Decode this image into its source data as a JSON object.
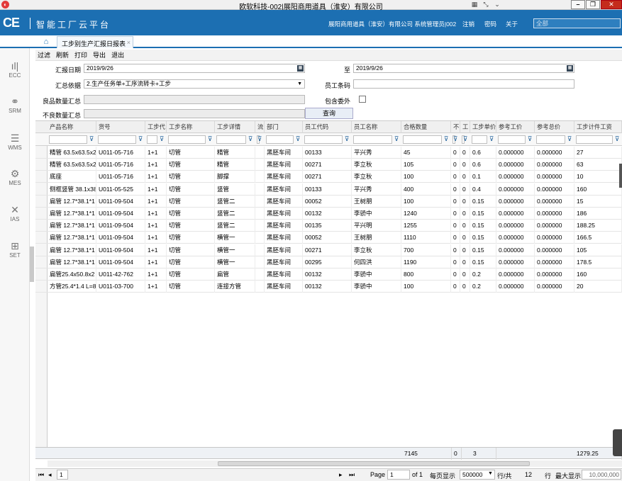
{
  "window": {
    "title": "欧软科技-002|展阳商用道具（淮安）有限公司"
  },
  "header": {
    "logo": "CE",
    "app_name": "智能工厂云平台",
    "company_user": "展阳商用道具（淮安）有限公司 系统管理员|002",
    "logout": "注销",
    "password": "密码",
    "about": "关于",
    "search_placeholder": "全部"
  },
  "tabs": [
    {
      "label": "工步别生产汇报日报表"
    }
  ],
  "sidebar": {
    "items": [
      {
        "label": "ECC",
        "icon": "bar-chart-icon"
      },
      {
        "label": "SRM",
        "icon": "network-icon"
      },
      {
        "label": "WMS",
        "icon": "database-icon"
      },
      {
        "label": "MES",
        "icon": "gear-icon"
      },
      {
        "label": "IAS",
        "icon": "tools-icon"
      },
      {
        "label": "SET",
        "icon": "settings-grid-icon"
      }
    ]
  },
  "toolbar": {
    "filter": "过滤",
    "refresh": "刷新",
    "print": "打印",
    "export": "导出",
    "exit": "退出"
  },
  "form": {
    "report_date_label": "汇报日期",
    "report_date_from": "2019/9/26",
    "to_label": "至",
    "report_date_to": "2019/9/26",
    "summary_basis_label": "汇总依据",
    "summary_basis_value": "2.生产任务单+工序流转卡+工步",
    "employee_code_label": "员工条码",
    "employee_code_value": "",
    "good_qty_label": "良品数量汇总",
    "good_qty_value": "",
    "include_outsource_label": "包含委外",
    "defect_qty_label": "不良数量汇总",
    "defect_qty_value": "",
    "query_button": "查询"
  },
  "grid": {
    "columns": [
      "产品名称",
      "货号",
      "工步代",
      "工步名称",
      "工步详情",
      "流",
      "部门",
      "员工代码",
      "员工名称",
      "合格数量",
      "不",
      "工",
      "工步单价",
      "参考工价",
      "参考总价",
      "工步计件工资"
    ],
    "rows": [
      [
        "精管 63.5x63.5x2",
        "U011-05-716",
        "1+1",
        "切管",
        "精管",
        "",
        "黑胚车间",
        "00133",
        "平兴秀",
        "45",
        "0",
        "0",
        "0.6",
        "0.000000",
        "0.000000",
        "27"
      ],
      [
        "精管 63.5x63.5x2",
        "U011-05-716",
        "1+1",
        "切管",
        "精管",
        "",
        "黑胚车间",
        "00271",
        "李立秋",
        "105",
        "0",
        "0",
        "0.6",
        "0.000000",
        "0.000000",
        "63"
      ],
      [
        "底座",
        "U011-05-716",
        "1+1",
        "切管",
        "脚撑",
        "",
        "黑胚车间",
        "00271",
        "李立秋",
        "100",
        "0",
        "0",
        "0.1",
        "0.000000",
        "0.000000",
        "10"
      ],
      [
        "侧框竖管 38.1x38",
        "U011-05-525",
        "1+1",
        "切管",
        "竖管",
        "",
        "黑胚车间",
        "00133",
        "平兴秀",
        "400",
        "0",
        "0",
        "0.4",
        "0.000000",
        "0.000000",
        "160"
      ],
      [
        "扁管 12.7*38.1*1",
        "U011-09-504",
        "1+1",
        "切管",
        "竖管二",
        "",
        "黑胚车间",
        "00052",
        "王树朋",
        "100",
        "0",
        "0",
        "0.15",
        "0.000000",
        "0.000000",
        "15"
      ],
      [
        "扁管 12.7*38.1*1",
        "U011-09-504",
        "1+1",
        "切管",
        "竖管二",
        "",
        "黑胚车间",
        "00132",
        "李骄中",
        "1240",
        "0",
        "0",
        "0.15",
        "0.000000",
        "0.000000",
        "186"
      ],
      [
        "扁管 12.7*38.1*1",
        "U011-09-504",
        "1+1",
        "切管",
        "竖管二",
        "",
        "黑胚车间",
        "00135",
        "平兴明",
        "1255",
        "0",
        "0",
        "0.15",
        "0.000000",
        "0.000000",
        "188.25"
      ],
      [
        "扁管 12.7*38.1*1",
        "U011-09-504",
        "1+1",
        "切管",
        "横管一",
        "",
        "黑胚车间",
        "00052",
        "王树朋",
        "1110",
        "0",
        "0",
        "0.15",
        "0.000000",
        "0.000000",
        "166.5"
      ],
      [
        "扁管 12.7*38.1*1",
        "U011-09-504",
        "1+1",
        "切管",
        "横管一",
        "",
        "黑胚车间",
        "00271",
        "李立秋",
        "700",
        "0",
        "0",
        "0.15",
        "0.000000",
        "0.000000",
        "105"
      ],
      [
        "扁管 12.7*38.1*1",
        "U011-09-504",
        "1+1",
        "切管",
        "横管一",
        "",
        "黑胚车间",
        "00295",
        "何四洪",
        "1190",
        "0",
        "0",
        "0.15",
        "0.000000",
        "0.000000",
        "178.5"
      ],
      [
        "扁管25.4x50.8x2",
        "U011-42-762",
        "1+1",
        "切管",
        "扁管",
        "",
        "黑胚车间",
        "00132",
        "李骄中",
        "800",
        "0",
        "0",
        "0.2",
        "0.000000",
        "0.000000",
        "160"
      ],
      [
        "方管25.4*1.4 L=8",
        "U011-03-700",
        "1+1",
        "切管",
        "连接方管",
        "",
        "黑胚车间",
        "00132",
        "李骄中",
        "100",
        "0",
        "0",
        "0.2",
        "0.000000",
        "0.000000",
        "20"
      ]
    ],
    "totals": {
      "qualified": "7145",
      "defect": "0",
      "unit": "3",
      "wage": "1279.25"
    }
  },
  "pager": {
    "page_label": "Page",
    "page_value": "1",
    "of_label": "of 1",
    "per_page_label": "每页显示",
    "per_page_value": "500000",
    "rows_total_label": "行/共",
    "rows_total": "12",
    "rows_label": "行",
    "max_label": "最大显示",
    "max_value": "10,000,000",
    "page_tab": "1"
  }
}
